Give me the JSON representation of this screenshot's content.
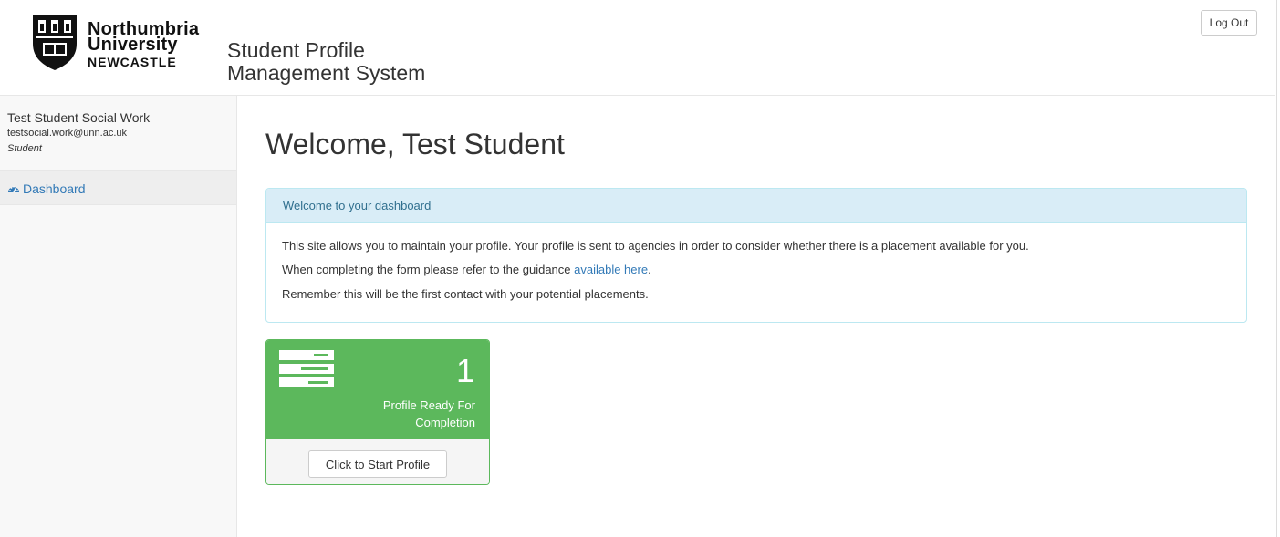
{
  "header": {
    "logo": {
      "line1": "Northumbria",
      "line2": "University",
      "line3": "NEWCASTLE"
    },
    "app_title_line1": "Student Profile",
    "app_title_line2": "Management System",
    "logout_label": "Log Out"
  },
  "sidebar": {
    "user_name": "Test Student Social Work",
    "user_email": "testsocial.work@unn.ac.uk",
    "user_role": "Student",
    "nav": [
      {
        "label": "Dashboard",
        "icon": "dashboard-icon"
      }
    ]
  },
  "main": {
    "title": "Welcome, Test Student",
    "panel": {
      "heading": "Welcome to your dashboard",
      "para1": "This site allows you to maintain your profile. Your profile is sent to agencies in order to consider whether there is a placement available for you.",
      "para2_prefix": "When completing the form please refer to the guidance ",
      "para2_link": "available here",
      "para2_suffix": ".",
      "para3": "Remember this will be the first contact with your potential placements."
    },
    "profile_card": {
      "icon": "server-icon",
      "count": "1",
      "label": "Profile Ready For Completion",
      "button_label": "Click to Start Profile"
    }
  },
  "colors": {
    "accent_link": "#337ab7",
    "success": "#5cb85c",
    "info_bg": "#d9edf7",
    "info_text": "#31708f"
  }
}
